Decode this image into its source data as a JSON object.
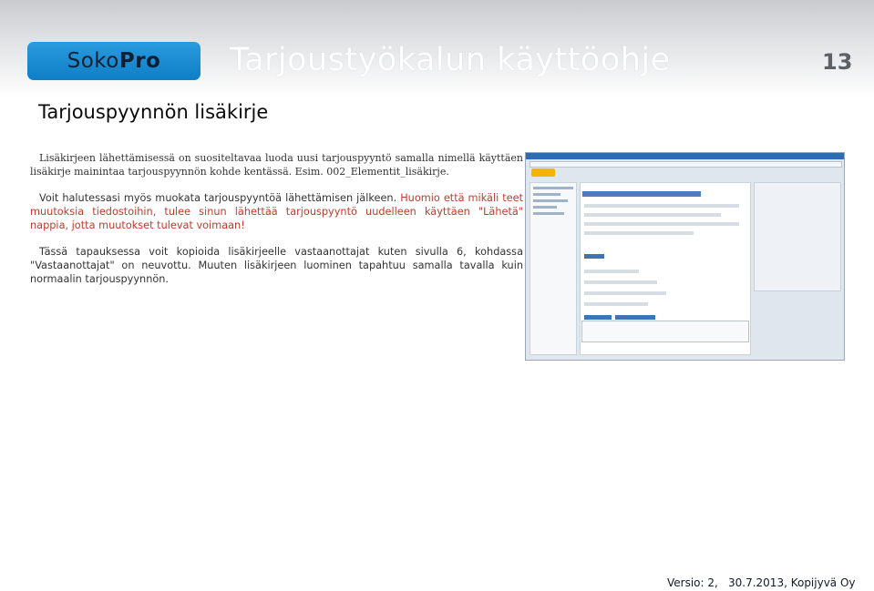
{
  "header": {
    "logo_part1": "Soko",
    "logo_part2": "Pro",
    "title": "Tarjoustyökalun käyttöohje",
    "page_number": "13"
  },
  "section": {
    "title": "Tarjouspyynnön lisäkirje"
  },
  "paragraphs": {
    "p1": "Lisäkirjeen lähettämisessä on suositeltavaa luoda uusi tarjouspyyntö samalla nimellä käyttäen lisäkirje mainintaa tarjouspyynnön kohde kentässä. Esim. 002_Elementit_lisäkirje.",
    "p2_normal": "Voit halutessasi myös muokata tarjouspyyntöä lähettämisen jälkeen.",
    "p2_red": "Huomio että mikäli teet muutoksia tiedostoihin, tulee sinun lähettää tarjouspyyntö uudelleen käyttäen \"Lähetä\" nappia, jotta muutokset tulevat voimaan!",
    "p3": "Tässä tapauksessa voit kopioida lisäkirjeelle vastaanottajat kuten sivulla 6, kohdassa \"Vastaanottajat\" on neuvottu. Muuten lisäkirjeen luominen tapahtuu samalla tavalla kuin normaalin tarjouspyynnön."
  },
  "footer": {
    "version": "Versio: 2,",
    "date_company": "30.7.2013, Kopijyvä Oy"
  },
  "colors": {
    "logo_blue": "#1089d2",
    "warning_red": "#c23a2a"
  }
}
